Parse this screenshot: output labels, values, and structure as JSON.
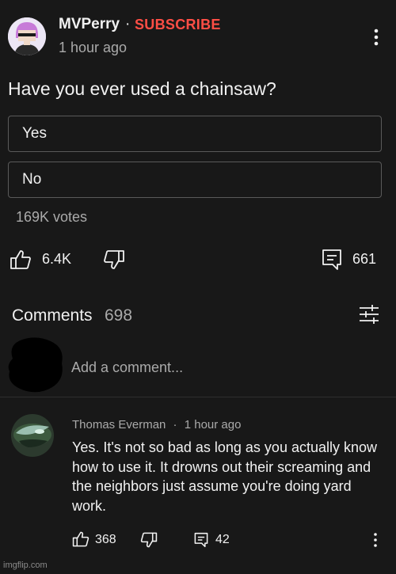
{
  "post": {
    "channel_name": "MVPerry",
    "separator": "·",
    "subscribe_label": "SUBSCRIBE",
    "time": "1 hour ago",
    "question": "Have you ever used a chainsaw?",
    "poll_options": [
      "Yes",
      "No"
    ],
    "votes": "169K votes",
    "likes": "6.4K",
    "comments": "661"
  },
  "comments_section": {
    "label": "Comments",
    "count": "698",
    "placeholder": "Add a comment..."
  },
  "comment": {
    "author": "Thomas Everman",
    "time": "1 hour ago",
    "text": "Yes. It's not so bad as long as you actually know how to use it. It drowns out their screaming and the neighbors just assume you're doing yard work.",
    "likes": "368",
    "replies": "42"
  },
  "watermark": "imgflip.com",
  "colors": {
    "background": "#181818",
    "text": "#f1f1f1",
    "muted": "#aaaaaa",
    "subscribe": "#ff4e45"
  },
  "icons": [
    "kebab-menu-icon",
    "thumbs-up-icon",
    "thumbs-down-icon",
    "comment-icon",
    "sort-icon",
    "reply-icon"
  ]
}
